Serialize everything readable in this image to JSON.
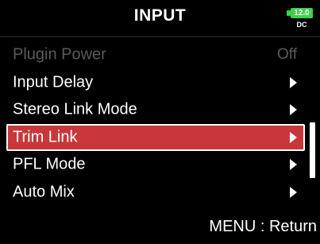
{
  "header": {
    "title": "INPUT",
    "battery": {
      "value": "12.0",
      "source": "DC"
    }
  },
  "menu": {
    "items": [
      {
        "label": "Plugin Power",
        "value": "Off",
        "state": "disabled"
      },
      {
        "label": "Input Delay"
      },
      {
        "label": "Stereo Link Mode"
      },
      {
        "label": "Trim Link",
        "state": "selected"
      },
      {
        "label": "PFL Mode"
      },
      {
        "label": "Auto Mix"
      }
    ]
  },
  "footer": {
    "hint": "MENU : Return"
  },
  "colors": {
    "background": "#000000",
    "selected_fill": "#c8373a",
    "battery": "#3fd14a",
    "disabled_text": "#5a5a5a"
  },
  "icons": [
    "battery-icon",
    "chevron-right-icon"
  ]
}
